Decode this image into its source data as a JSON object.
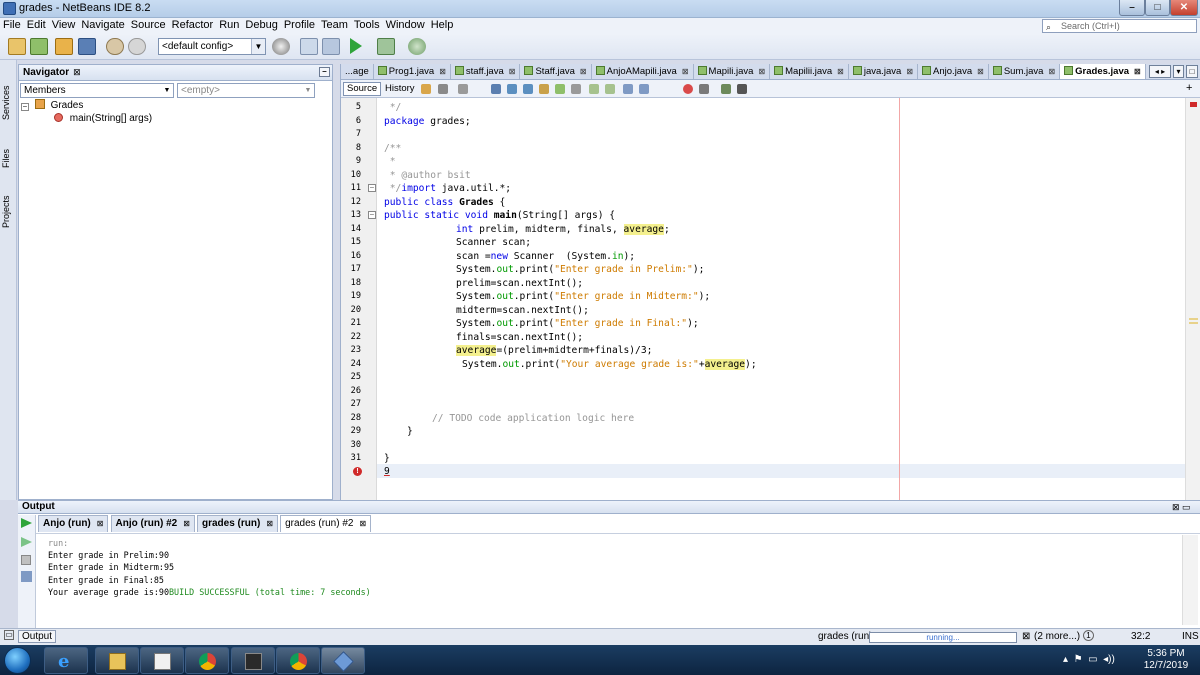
{
  "window": {
    "title": "grades - NetBeans IDE 8.2"
  },
  "menu": [
    "File",
    "Edit",
    "View",
    "Navigate",
    "Source",
    "Refactor",
    "Run",
    "Debug",
    "Profile",
    "Team",
    "Tools",
    "Window",
    "Help"
  ],
  "search": {
    "placeholder": "Search (Ctrl+I)"
  },
  "toolbar": {
    "config": "<default config>"
  },
  "side_tabs": [
    "Services",
    "Files",
    "Projects"
  ],
  "navigator": {
    "title": "Navigator",
    "filter": "Members",
    "filter2": "<empty>",
    "tree": {
      "root": "Grades",
      "child": "main(String[] args)"
    }
  },
  "editor": {
    "tabs": [
      "...age",
      "Prog1.java",
      "staff.java",
      "Staff.java",
      "AnjoAMapili.java",
      "Mapili.java",
      "Mapilii.java",
      "java.java",
      "Anjo.java",
      "Sum.java",
      "Grades.java"
    ],
    "active_tab": "Grades.java",
    "source_btn": "Source",
    "history_btn": "History",
    "line_numbers": [
      "5",
      "6",
      "7",
      "8",
      "9",
      "10",
      "11",
      "12",
      "13",
      "14",
      "15",
      "16",
      "17",
      "18",
      "19",
      "20",
      "21",
      "22",
      "23",
      "24",
      "25",
      "26",
      "27",
      "28",
      "29",
      "30",
      "31",
      ""
    ],
    "code": {
      "l5": " */",
      "l6a": "package",
      "l6b": " grades;",
      "l8": "/**",
      "l9": " *",
      "l10": " * @author bsit",
      "l11a": " */",
      "l11b": "import",
      "l11c": " java.util.*;",
      "l12a": "public class",
      "l12b": " Grades",
      "l12c": " {",
      "l13a": "public static void",
      "l13b": " main",
      "l13c": "(String[] args) {",
      "l14a": "int",
      "l14b": " prelim, midterm, finals, ",
      "l14c": "average",
      "l14d": ";",
      "l15": "Scanner scan;",
      "l16a": "scan =",
      "l16b": "new",
      "l16c": " Scanner  (System.",
      "l16d": "in",
      "l16e": ");",
      "l17a": "System.",
      "l17b": "out",
      "l17c": ".print(",
      "l17d": "\"Enter grade in Prelim:\"",
      "l17e": ");",
      "l18": "prelim=scan.nextInt();",
      "l19d": "\"Enter grade in Midterm:\"",
      "l20": "midterm=scan.nextInt();",
      "l21d": "\"Enter grade in Final:\"",
      "l22": "finals=scan.nextInt();",
      "l23a": "average",
      "l23b": "=(prelim+midterm+finals)/3;",
      "l24d": "\"Your average grade is:\"",
      "l24e": "+",
      "l24f": "average",
      "l24g": ");",
      "l28": "// TODO code application logic here",
      "l29": "}",
      "l31": "}",
      "l32": "9"
    }
  },
  "output": {
    "title": "Output",
    "tabs": [
      "Anjo (run)",
      "Anjo (run) #2",
      "grades (run)",
      "grades (run) #2"
    ],
    "lines": {
      "run": "run:",
      "p": "Enter grade in Prelim:90",
      "m": "Enter grade in Midterm:95",
      "f": "Enter grade in Final:85",
      "avg": "Your average grade is:90",
      "build": "BUILD SUCCESSFUL (total time: 7 seconds)"
    }
  },
  "status": {
    "output_btn": "Output",
    "task": "grades (run)",
    "progress_text": "running...",
    "more": "(2 more...)",
    "position": "32:2",
    "mode": "INS"
  },
  "taskbar": {
    "time": "5:36 PM",
    "date": "12/7/2019"
  },
  "colors": {
    "keyword": "#0000e6",
    "string": "#ce7b00",
    "comment": "#969696",
    "field": "#009900",
    "highlight": "#f4f08e"
  }
}
